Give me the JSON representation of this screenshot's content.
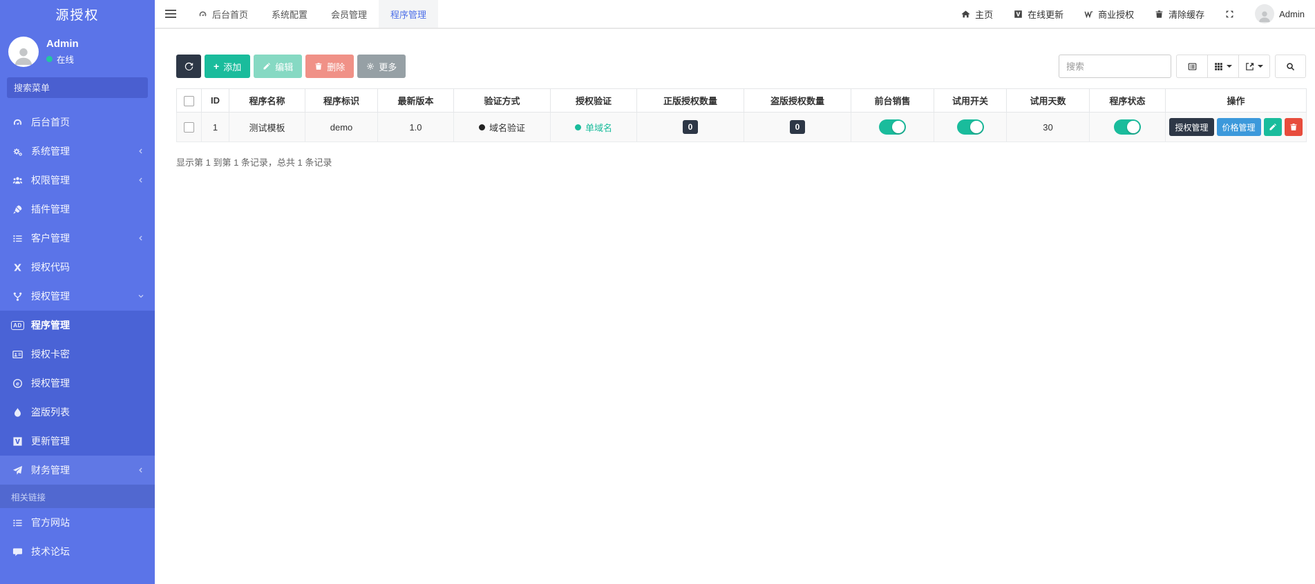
{
  "brand": {
    "title": "源授权"
  },
  "user": {
    "name": "Admin",
    "status_label": "在线"
  },
  "sidebar": {
    "search_placeholder": "搜索菜单",
    "items": [
      {
        "label": "后台首页",
        "icon": "dashboard-icon"
      },
      {
        "label": "系统管理",
        "icon": "cogs-icon",
        "has_children": true
      },
      {
        "label": "权限管理",
        "icon": "users-icon",
        "has_children": true
      },
      {
        "label": "插件管理",
        "icon": "rocket-icon"
      },
      {
        "label": "客户管理",
        "icon": "list-icon",
        "has_children": true
      },
      {
        "label": "授权代码",
        "icon": "x-shape-icon"
      },
      {
        "label": "授权管理",
        "icon": "branch-icon",
        "has_children": true,
        "expanded": true
      },
      {
        "label": "程序管理",
        "icon": "ad-icon",
        "active": true,
        "level": 2
      },
      {
        "label": "授权卡密",
        "icon": "id-card-icon",
        "level": 2
      },
      {
        "label": "授权管理",
        "icon": "explorer-icon",
        "level": 2
      },
      {
        "label": "盗版列表",
        "icon": "droplet-icon",
        "level": 2
      },
      {
        "label": "更新管理",
        "icon": "v-square-icon",
        "level": 2
      },
      {
        "label": "财务管理",
        "icon": "paper-plane-icon",
        "has_children": true
      }
    ],
    "section_label": "相关链接",
    "links": [
      {
        "label": "官方网站",
        "icon": "list-red-icon"
      },
      {
        "label": "技术论坛",
        "icon": "comment-icon"
      }
    ]
  },
  "navbar": {
    "tabs": [
      {
        "label": "后台首页",
        "icon": "dashboard-icon"
      },
      {
        "label": "系统配置"
      },
      {
        "label": "会员管理"
      },
      {
        "label": "程序管理",
        "active": true
      }
    ],
    "actions": [
      {
        "label": "主页",
        "icon": "home-icon"
      },
      {
        "label": "在线更新",
        "icon": "v-square-icon"
      },
      {
        "label": "商业授权",
        "icon": "w-icon"
      },
      {
        "label": "清除缓存",
        "icon": "trash-icon"
      }
    ],
    "admin_label": "Admin"
  },
  "toolbar": {
    "add_label": "添加",
    "edit_label": "编辑",
    "delete_label": "删除",
    "more_label": "更多",
    "search_placeholder": "搜索"
  },
  "table": {
    "columns": [
      "ID",
      "程序名称",
      "程序标识",
      "最新版本",
      "验证方式",
      "授权验证",
      "正版授权数量",
      "盗版授权数量",
      "前台销售",
      "试用开关",
      "试用天数",
      "程序状态",
      "操作"
    ],
    "rows": [
      {
        "id": "1",
        "name": "测试模板",
        "identifier": "demo",
        "version": "1.0",
        "verify_method": "域名验证",
        "auth_verify": "单域名",
        "genuine_count": "0",
        "pirated_count": "0",
        "front_sale_on": true,
        "trial_switch_on": true,
        "trial_days": "30",
        "status_on": true,
        "action_auth": "授权管理",
        "action_price": "价格管理"
      }
    ],
    "summary": "显示第 1 到第 1 条记录，总共 1 条记录"
  },
  "icons": {
    "ad_glyph": "AD"
  },
  "colors": {
    "sidebar": "#5b74e8",
    "sidebar_submenu": "#4a63d6",
    "accent_green": "#1abc9c",
    "navy": "#2d3746",
    "blue": "#3c99db",
    "red": "#e74c3c",
    "tab_active_text": "#4d6fe8"
  }
}
